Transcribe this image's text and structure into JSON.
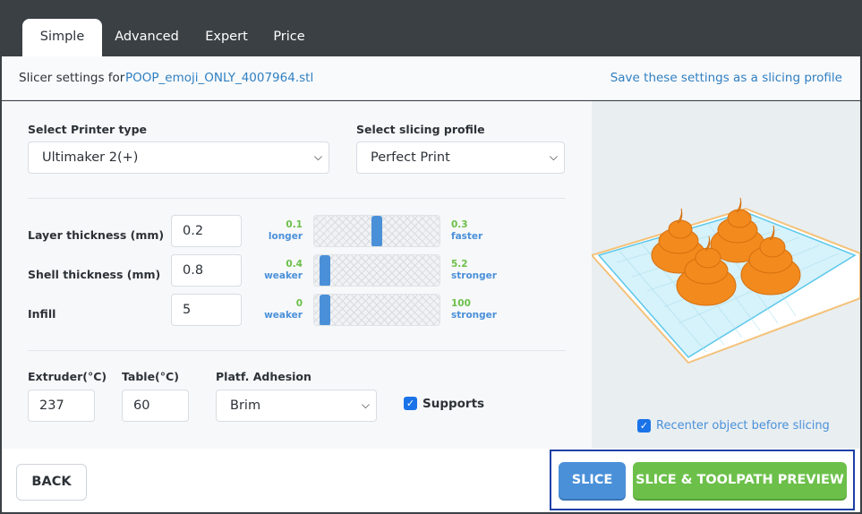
{
  "tabs": [
    {
      "label": "Simple",
      "active": true
    },
    {
      "label": "Advanced",
      "active": false
    },
    {
      "label": "Expert",
      "active": false
    },
    {
      "label": "Price",
      "active": false
    }
  ],
  "header": {
    "label": "Slicer settings for",
    "filename": "POOP_emoji_ONLY_4007964.stl",
    "save_link": "Save these settings as a slicing profile"
  },
  "printer": {
    "label": "Select Printer type",
    "value": "Ultimaker 2(+)"
  },
  "profile": {
    "label": "Select slicing profile",
    "value": "Perfect Print"
  },
  "settings": [
    {
      "label": "Layer thickness (mm)",
      "value": "0.2",
      "min": "0.1",
      "min_word": "longer",
      "max": "0.3",
      "max_word": "faster",
      "level": 0.5
    },
    {
      "label": "Shell thickness (mm)",
      "value": "0.8",
      "min": "0.4",
      "min_word": "weaker",
      "max": "5.2",
      "max_word": "stronger",
      "level": 0.05
    },
    {
      "label": "Infill",
      "value": "5",
      "min": "0",
      "min_word": "weaker",
      "max": "100",
      "max_word": "stronger",
      "level": 0.05
    }
  ],
  "extruder": {
    "label": "Extruder(°C)",
    "value": "237"
  },
  "table": {
    "label": "Table(°C)",
    "value": "60"
  },
  "adhesion": {
    "label": "Platf. Adhesion",
    "value": "Brim"
  },
  "supports": {
    "label": "Supports",
    "checked": true
  },
  "recenter": {
    "label": "Recenter object before slicing",
    "checked": true
  },
  "buttons": {
    "back": "BACK",
    "slice": "SLICE",
    "preview": "SLICE & TOOLPATH PREVIEW"
  },
  "colors": {
    "accent_blue": "#4a90d9",
    "accent_green": "#6cc04a",
    "model_orange": "#f28a1e"
  }
}
